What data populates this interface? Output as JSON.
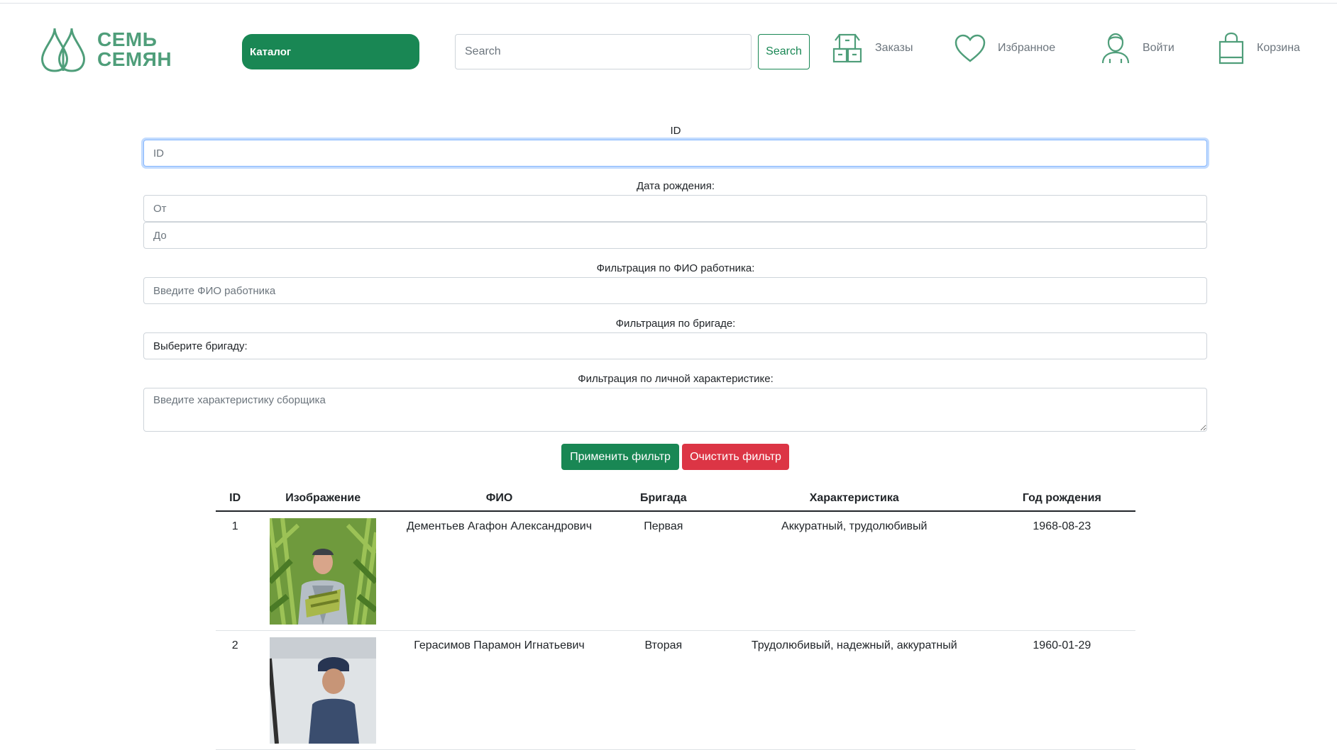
{
  "header": {
    "logo_line1": "СЕМЬ",
    "logo_line2": "СЕМЯН",
    "catalog_label": "Каталог",
    "search_placeholder": "Search",
    "search_button": "Search",
    "nav": [
      {
        "label": "Заказы",
        "icon": "boxes-icon"
      },
      {
        "label": "Избранное",
        "icon": "heart-icon"
      },
      {
        "label": "Войти",
        "icon": "user-icon"
      },
      {
        "label": "Корзина",
        "icon": "shopping-bag-icon"
      }
    ],
    "accent_color": "#4f9e7a"
  },
  "filters": {
    "id_label": "ID",
    "id_placeholder": "ID",
    "birth_label": "Дата рождения:",
    "from_placeholder": "От",
    "to_placeholder": "До",
    "fio_label": "Фильтрация по ФИО работника:",
    "fio_placeholder": "Введите ФИО работника",
    "brigade_label": "Фильтрация по бригаде:",
    "brigade_selected": "Выберите бригаду:",
    "trait_label": "Фильтрация по личной характеристике:",
    "trait_placeholder": "Введите характеристику сборщика",
    "apply_button": "Применить фильтр",
    "clear_button": "Очистить фильтр",
    "apply_color": "#198754",
    "clear_color": "#dc3545"
  },
  "table": {
    "columns": [
      "ID",
      "Изображение",
      "ФИО",
      "Бригада",
      "Характеристика",
      "Год рождения"
    ],
    "rows": [
      {
        "id": "1",
        "fio": "Дементьев Агафон Александрович",
        "brigade": "Первая",
        "trait": "Аккуратный, трудолюбивый",
        "birth": "1968-08-23"
      },
      {
        "id": "2",
        "fio": "Герасимов Парамон Игнатьевич",
        "brigade": "Вторая",
        "trait": "Трудолюбивый, надежный, аккуратный",
        "birth": "1960-01-29"
      }
    ]
  }
}
